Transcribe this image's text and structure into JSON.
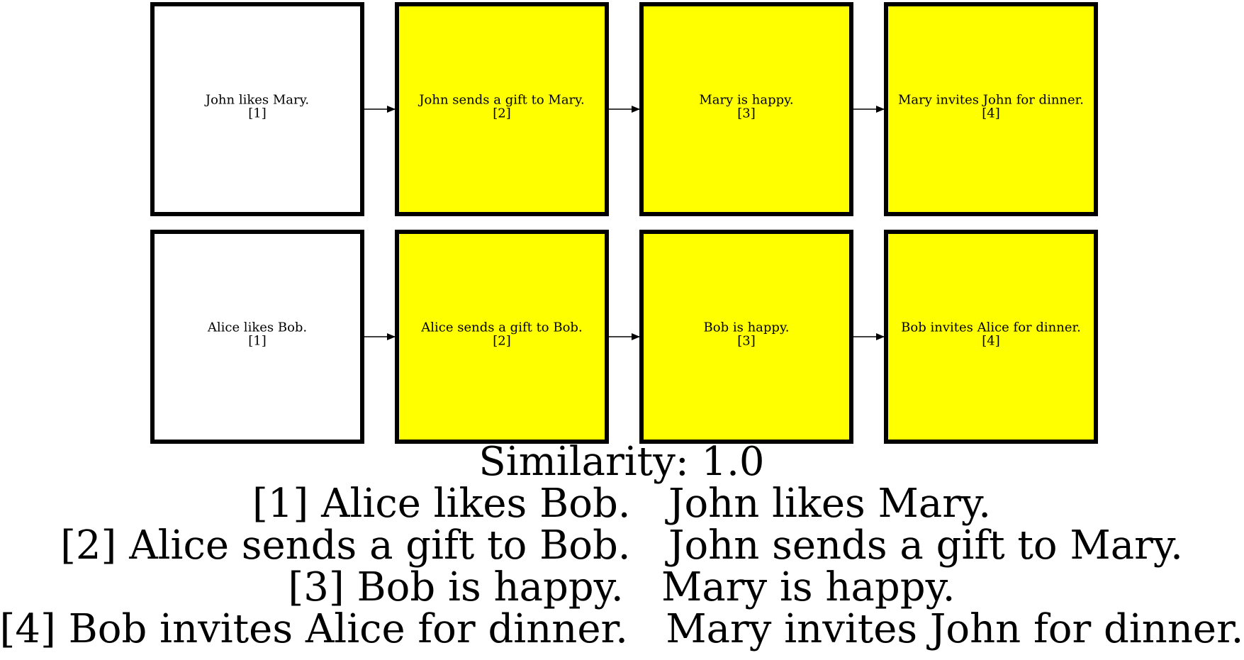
{
  "diagram": {
    "colors": {
      "highlight_fill": "#ffff00",
      "plain_fill": "#ffffff",
      "stroke": "#000000"
    },
    "rows": [
      {
        "nodes": [
          {
            "text": "John likes Mary.",
            "index": "[1]",
            "highlighted": false
          },
          {
            "text": "John sends a gift to Mary.",
            "index": "[2]",
            "highlighted": true
          },
          {
            "text": "Mary is happy.",
            "index": "[3]",
            "highlighted": true
          },
          {
            "text": "Mary invites John for dinner.",
            "index": "[4]",
            "highlighted": true
          }
        ]
      },
      {
        "nodes": [
          {
            "text": "Alice likes Bob.",
            "index": "[1]",
            "highlighted": false
          },
          {
            "text": "Alice sends a gift to Bob.",
            "index": "[2]",
            "highlighted": true
          },
          {
            "text": "Bob is happy.",
            "index": "[3]",
            "highlighted": true
          },
          {
            "text": "Bob invites Alice for dinner.",
            "index": "[4]",
            "highlighted": true
          }
        ]
      }
    ]
  },
  "caption": {
    "similarity": "Similarity: 1.0",
    "pairs": [
      {
        "index": "[1]",
        "left": "Alice likes Bob.",
        "right": "John likes Mary."
      },
      {
        "index": "[2]",
        "left": "Alice sends a gift to Bob.",
        "right": "John sends a gift to Mary."
      },
      {
        "index": "[3]",
        "left": "Bob is happy.",
        "right": "Mary is happy."
      },
      {
        "index": "[4]",
        "left": "Bob invites Alice for dinner.",
        "right": "Mary invites John for dinner."
      }
    ]
  }
}
